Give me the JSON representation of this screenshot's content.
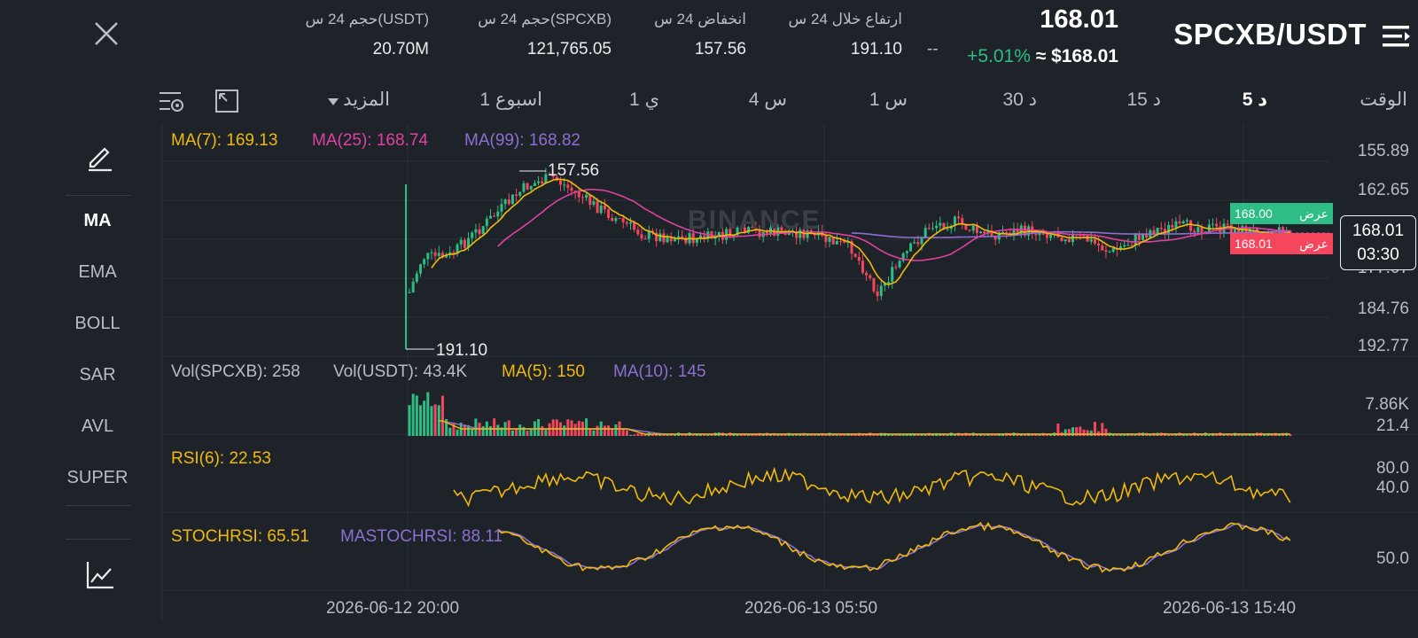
{
  "header": {
    "pair": "SPCXB/USDT",
    "last_price": "168.01",
    "usd_price": "≈ $168.01",
    "change": "+5.01%",
    "dash": "--",
    "stats": [
      {
        "label": "ارتفاع خلال 24 س",
        "value": "191.10"
      },
      {
        "label": "انخفاض 24 س",
        "value": "157.56"
      },
      {
        "label": "حجم 24 س(SPCXB)",
        "value": "121,765.05"
      },
      {
        "label": "حجم 24 س(USDT)",
        "value": "20.70M"
      }
    ]
  },
  "intervals": {
    "label": "الوقت",
    "items": [
      "5 د",
      "15 د",
      "30 د",
      "1 س",
      "4 س",
      "1 ي",
      "1 اسبوع"
    ],
    "active": "5 د",
    "more": "المزيد"
  },
  "sidebar": {
    "items": [
      "MA",
      "EMA",
      "BOLL",
      "SAR",
      "AVL",
      "SUPER"
    ],
    "active": "MA"
  },
  "indicators": {
    "ma7": "MA(7): 169.13",
    "ma25": "MA(25): 168.74",
    "ma99": "MA(99): 168.82",
    "vol_base": "Vol(SPCXB): 258",
    "vol_quote": "Vol(USDT): 43.4K",
    "vol_ma5": "MA(5): 150",
    "vol_ma10": "MA(10): 145",
    "rsi": "RSI(6): 22.53",
    "stochrsi": "STOCHRSI: 65.51",
    "mastochrsi": "MASTOCHRSI: 88.11"
  },
  "price_axis": [
    "155.89",
    "162.65",
    "177.07",
    "184.76",
    "192.77"
  ],
  "volume_axis": [
    "7.86K",
    "21.4"
  ],
  "rsi_axis": [
    "80.0",
    "40.0"
  ],
  "stoch_axis": [
    "50.0"
  ],
  "time_axis": [
    "2026-06-12 20:00",
    "2026-06-13 05:50",
    "2026-06-13 15:40"
  ],
  "annotations": {
    "high_label": "157.56",
    "low_label": "191.10"
  },
  "order_tags": [
    {
      "label": "عرض",
      "price": "168.00",
      "color": "#2ebd85"
    },
    {
      "label": "عرض",
      "price": "168.01",
      "color": "#f6465d"
    }
  ],
  "current_price_box": {
    "price": "168.01",
    "countdown": "03:30"
  },
  "watermark": "BINANCE",
  "colors": {
    "background": "#1e2329",
    "up": "#2ebd85",
    "down": "#f6465d",
    "ma7": "#f0b90b",
    "ma25": "#e040a0",
    "ma99": "#8c6fd1"
  },
  "chart_data": {
    "type": "candlestick",
    "x_range": [
      "2026-06-12 20:00",
      "2026-06-13 15:40"
    ],
    "price_range": [
      155.89,
      192.77
    ],
    "high_24h": 191.1,
    "low_24h": 157.56,
    "last": 168.01,
    "series": [
      {
        "name": "MA(7)",
        "value": 169.13
      },
      {
        "name": "MA(25)",
        "value": 168.74
      },
      {
        "name": "MA(99)",
        "value": 168.82
      }
    ]
  }
}
